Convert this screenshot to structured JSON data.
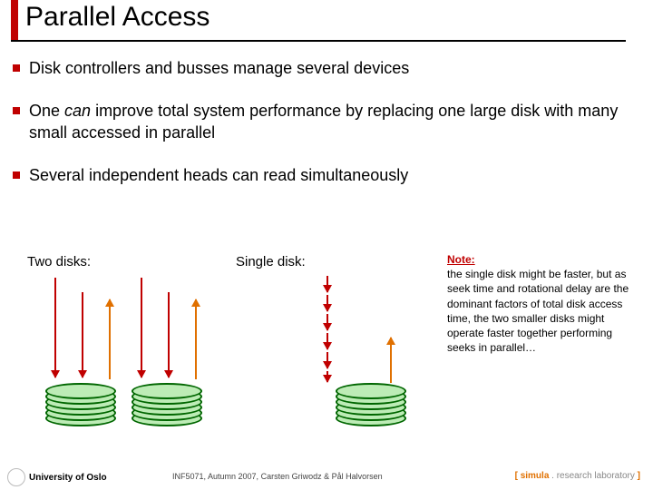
{
  "title": "Parallel Access",
  "bullets": [
    {
      "pre": "Disk controllers and busses manage several devices",
      "em": "",
      "post": ""
    },
    {
      "pre": "One ",
      "em": "can",
      "post": "  improve total system performance by replacing one large disk with many small accessed in parallel"
    },
    {
      "pre": "Several independent heads can read simultaneously",
      "em": "",
      "post": ""
    }
  ],
  "diagram": {
    "two_label": "Two disks:",
    "single_label": "Single disk:"
  },
  "note": {
    "title": "Note:",
    "body": "the single disk might be faster, but as seek time and rotational delay are the dominant factors of total disk access time, the two smaller disks might operate faster together performing seeks in parallel…"
  },
  "footer": {
    "uio": "University of Oslo",
    "course": "INF5071, Autumn 2007, Carsten Griwodz & Pål Halvorsen",
    "sim_open": "[ ",
    "sim_word": "simula",
    "sim_mid": " . research laboratory",
    "sim_close": " ]"
  }
}
